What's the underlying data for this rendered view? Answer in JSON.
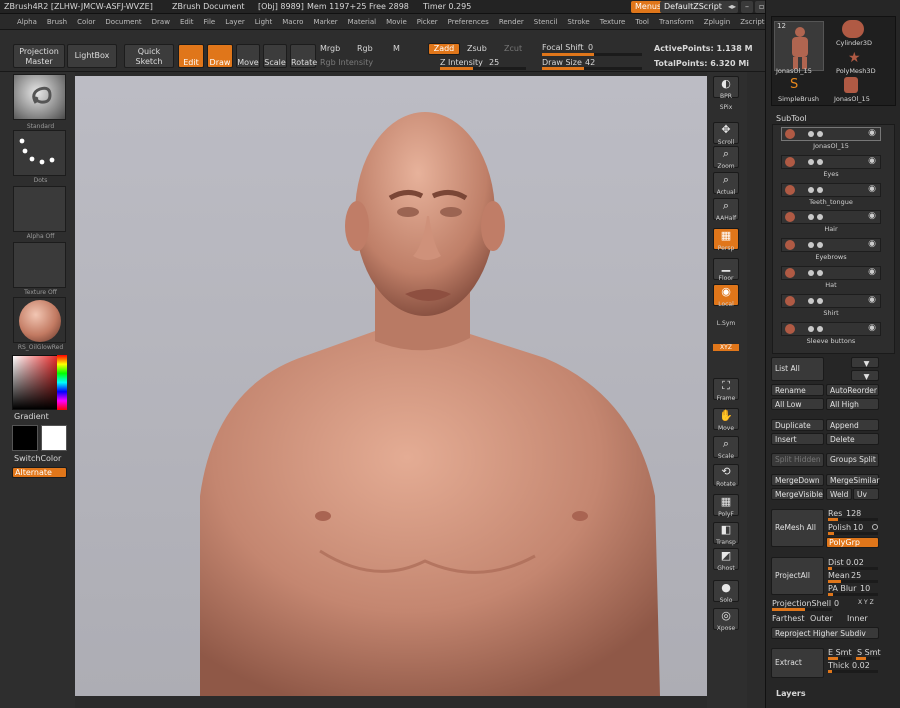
{
  "titlebar": {
    "app": "ZBrush4R2 [ZLHW-JMCW-ASFJ-WVZE]",
    "doc": "ZBrush Document",
    "obj": "[Obj] 8989]",
    "mem": "Mem 1197+25",
    "free": "Free 2898",
    "timer": "Timer 0.295",
    "menus_btn": "Menus",
    "script_btn": "DefaultZScript"
  },
  "menubar": [
    "Alpha",
    "Brush",
    "Color",
    "Document",
    "Draw",
    "Edit",
    "File",
    "Layer",
    "Light",
    "Macro",
    "Marker",
    "Material",
    "Movie",
    "Picker",
    "Preferences",
    "Render",
    "Stencil",
    "Stroke",
    "Texture",
    "Tool",
    "Transform",
    "Zplugin",
    "Zscript"
  ],
  "toolbar": {
    "projection_master": "Projection Master",
    "lightbox": "LightBox",
    "quick_sketch": "Quick Sketch",
    "edit": "Edit",
    "draw": "Draw",
    "move": "Move",
    "scale": "Scale",
    "rotate": "Rotate",
    "mrgb": "Mrgb",
    "rgb": "Rgb",
    "m": "M",
    "zadd": "Zadd",
    "zsub": "Zsub",
    "zcut": "Zcut",
    "rgb_intensity": "Rgb Intensity",
    "z_intensity_label": "Z Intensity",
    "z_intensity": "25",
    "focal_shift_label": "Focal Shift",
    "focal_shift": "0",
    "draw_size_label": "Draw Size",
    "draw_size": "42",
    "active_points": "ActivePoints: 1.138 M",
    "total_points": "TotalPoints: 6.320 Mi"
  },
  "left": {
    "brush": "Standard",
    "stroke": "Dots",
    "alpha": "Alpha Off",
    "texture": "Texture Off",
    "material": "RS_OilGlowRed",
    "gradient": "Gradient",
    "switchcolor": "SwitchColor",
    "alternate": "Alternate"
  },
  "shelf": [
    "BPR",
    "SPix",
    "Scroll",
    "Zoom",
    "Actual",
    "AAHalf",
    "Persp",
    "Floor",
    "Local",
    "L.Sym",
    "XYZ",
    "Frame",
    "Move",
    "Scale",
    "Rotate",
    "PolyF",
    "Transp",
    "Ghost",
    "Solo",
    "Xpose"
  ],
  "tray": {
    "tool_thumb_1": "JonasOl_15",
    "tool_thumb_2": "Cylinder3D",
    "tool_thumb_3": "PolyMesh3D",
    "tool_thumb_4": "SimpleBrush",
    "tool_thumb_5": "JonasOl_15",
    "tool_count": "12",
    "subtool_title": "SubTool",
    "subtools": [
      "JonasOl_15",
      "Eyes",
      "Teeth_tongue",
      "Hair",
      "Eyebrows",
      "Hat",
      "Shirt",
      "Sleeve buttons"
    ],
    "list_all": "List All",
    "rename": "Rename",
    "autoreorder": "AutoReorder",
    "all_low": "All Low",
    "all_high": "All High",
    "duplicate": "Duplicate",
    "append": "Append",
    "insert": "Insert",
    "delete": "Delete",
    "split_hidden": "Split Hidden",
    "groups_split": "Groups Split",
    "merge_down": "MergeDown",
    "merge_similar": "MergeSimilar",
    "merge_visible": "MergeVisible",
    "weld": "Weld",
    "uv": "Uv",
    "remesh_all": "ReMesh All",
    "res_label": "Res",
    "res": "128",
    "polish_label": "Polish",
    "polish": "10",
    "polygrp": "PolyGrp",
    "project_all": "ProjectAll",
    "dist_label": "Dist",
    "dist": "0.02",
    "mean_label": "Mean",
    "mean": "25",
    "pa_blur_label": "PA Blur",
    "pa_blur": "10",
    "projection_shell_label": "ProjectionShell",
    "projection_shell": "0",
    "xyz_flag": "X Y Z",
    "farthest": "Farthest",
    "outer": "Outer",
    "inner": "Inner",
    "reproject": "Reproject Higher Subdiv",
    "extract": "Extract",
    "e_smt": "E Smt",
    "s_smt": "S Smt",
    "thick_label": "Thick",
    "thick": "0.02",
    "layers": "Layers"
  },
  "colors": {
    "accent": "#e0761a",
    "panel": "#2e2e2e",
    "viewport": "#b4b4bb",
    "skin": "#c98e77"
  }
}
